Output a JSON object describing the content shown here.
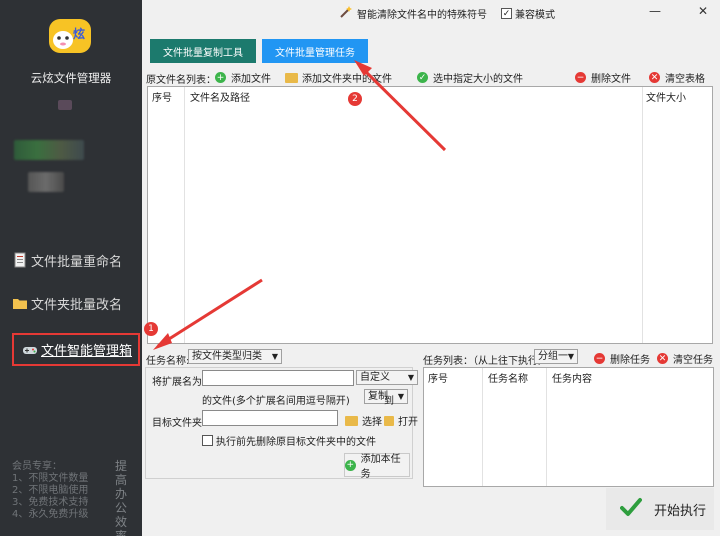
{
  "sidebar": {
    "app_name": "云炫文件管理器",
    "logo_text": "炫",
    "nav": [
      {
        "label": "文件批量重命名",
        "icon": "document-icon"
      },
      {
        "label": "文件夹批量改名",
        "icon": "folder-icon"
      },
      {
        "label": "文件智能管理箱",
        "icon": "gamepad-icon"
      }
    ],
    "member_text": [
      "会员专享：",
      "1、不限文件数量",
      "2、不限电脑使用",
      "3、免费技术支持",
      "4、永久免费升级"
    ],
    "side_slogan": "提高办公效率"
  },
  "topbar": {
    "clean_label": "智能清除文件名中的特殊符号",
    "compat_label": "兼容模式",
    "compat_checked": true
  },
  "tabs": [
    {
      "label": "文件批量复制工具"
    },
    {
      "label": "文件批量管理任务"
    }
  ],
  "filelist": {
    "title": "原文件名列表：",
    "add_file": "添加文件",
    "add_folder": "添加文件夹中的文件",
    "select_size": "选中指定大小的文件",
    "delete_file": "删除文件",
    "clear_table": "清空表格",
    "columns": [
      "序号",
      "文件名及路径",
      "文件大小"
    ]
  },
  "task": {
    "name_label": "任务名称:",
    "name_value": "按文件类型归类",
    "ext_label": "将扩展名为:",
    "ext_value": "",
    "custom": "自定义",
    "ext_hint": "的文件(多个扩展名间用逗号隔开)",
    "action": "复制",
    "to": "到",
    "target_label": "目标文件夹:",
    "target_value": "",
    "choose": "选择",
    "open": "打开",
    "delete_first": "执行前先删除原目标文件夹中的文件",
    "add_task": "添加本任务"
  },
  "tasklist": {
    "title": "任务列表：（从上往下执行）",
    "group": "分组一",
    "delete_task": "删除任务",
    "clear_task": "清空任务",
    "columns": [
      "序号",
      "任务名称",
      "任务内容"
    ]
  },
  "start_button": "开始执行",
  "annotations": [
    "1",
    "2"
  ],
  "colors": {
    "sidebar": "#2e3135",
    "tab_copy": "#1c7a6d",
    "tab_manage": "#2196f3",
    "accent_red": "#e53935",
    "green": "#3cb44b"
  }
}
